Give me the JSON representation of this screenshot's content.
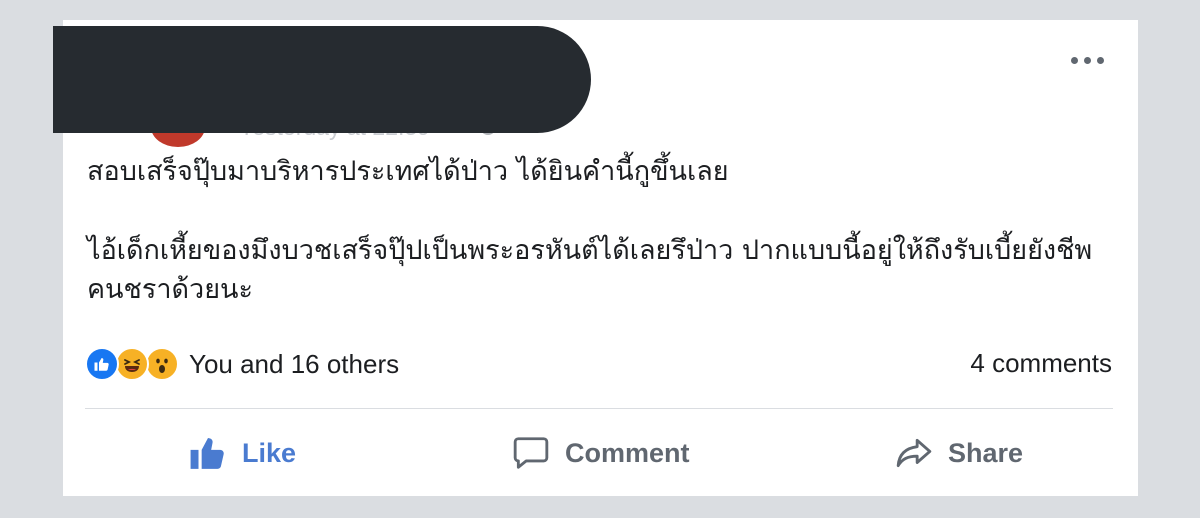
{
  "post": {
    "timestamp": "Yesterday at 22:39",
    "paragraph_1": "สอบเสร็จปุ๊บมาบริหารประเทศได้ป่าว ได้ยินคำนี้กูขึ้นเลย",
    "paragraph_2": "ไอ้เด็กเหี้ยของมึงบวชเสร็จปุ๊ปเป็นพระอรหันต์ได้เลยรึป่าว ปากแบบนี้อยู่ให้ถึงรับเบี้ยยังชีพคนชราด้วยนะ"
  },
  "reactions": {
    "icons": [
      "like-reaction-icon",
      "haha-reaction-icon",
      "wow-reaction-icon"
    ],
    "summary": "You and 16 others",
    "comments": "4 comments"
  },
  "actions": {
    "like_label": "Like",
    "comment_label": "Comment",
    "share_label": "Share"
  },
  "colors": {
    "background": "#dadde1",
    "like_blue": "#4a7bd0",
    "muted": "#606770",
    "redaction": "#262b30"
  }
}
